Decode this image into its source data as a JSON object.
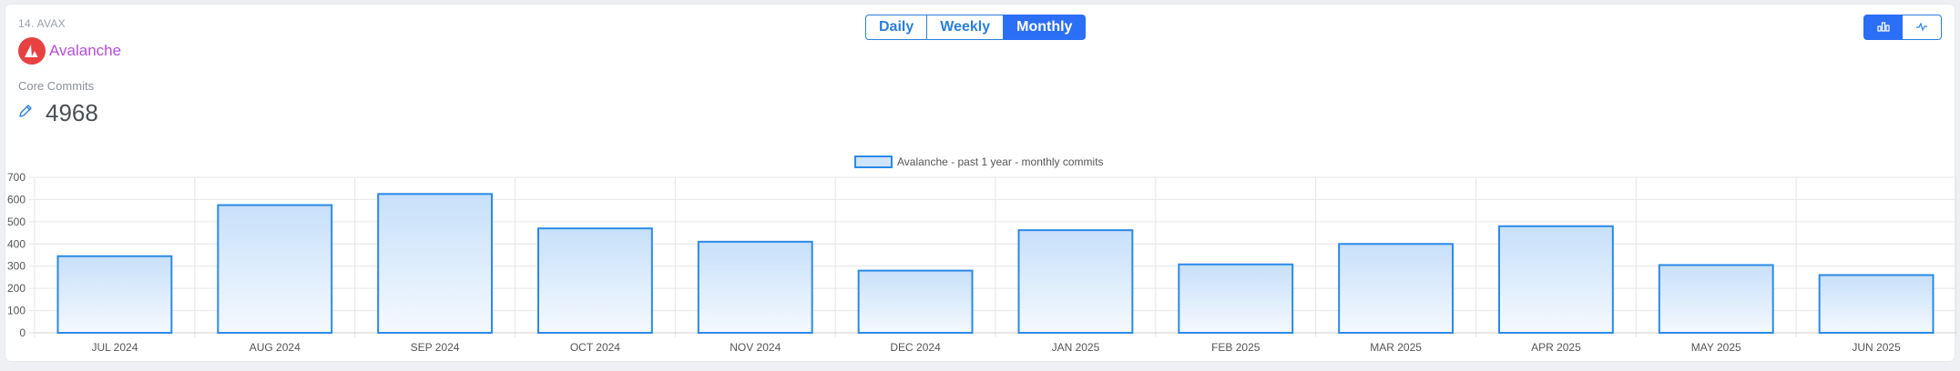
{
  "header": {
    "rank": "14. AVAX",
    "name": "Avalanche",
    "metric_label": "Core Commits",
    "metric_value": "4968"
  },
  "period_toggle": {
    "options": [
      "Daily",
      "Weekly",
      "Monthly"
    ],
    "selected": "Monthly"
  },
  "chart_type_toggle": {
    "options": [
      "bar-chart-icon",
      "line-chart-icon"
    ],
    "selected": "bar-chart-icon"
  },
  "colors": {
    "accent": "#2a6ff5",
    "bar_stroke": "#2b8ae6",
    "bar_fill_top": "#c7e0fa",
    "bar_fill_bottom": "#f4f9fe",
    "logo": "#e84142",
    "brand_text": "#b44fd6"
  },
  "chart_data": {
    "type": "bar",
    "legend": "Avalanche - past 1 year - monthly commits",
    "legend_position": "top-center",
    "categories": [
      "JUL 2024",
      "AUG 2024",
      "SEP 2024",
      "OCT 2024",
      "NOV 2024",
      "DEC 2024",
      "JAN 2025",
      "FEB 2025",
      "MAR 2025",
      "APR 2025",
      "MAY 2025",
      "JUN 2025"
    ],
    "series": [
      {
        "name": "Avalanche - past 1 year - monthly commits",
        "values": [
          345,
          575,
          625,
          470,
          410,
          280,
          462,
          308,
          400,
          480,
          305,
          260
        ]
      }
    ],
    "ylim": [
      0,
      700
    ],
    "yticks": [
      "0",
      "100",
      "200",
      "300",
      "400",
      "500",
      "600",
      "700"
    ],
    "grid": true
  }
}
